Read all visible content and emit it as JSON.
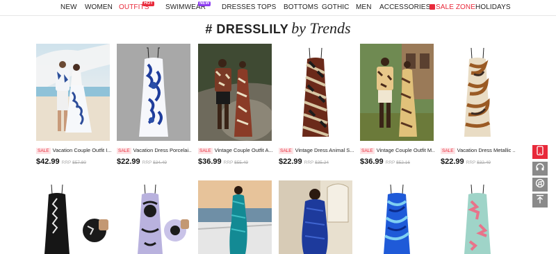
{
  "nav": {
    "items": [
      {
        "label": "NEW"
      },
      {
        "label": "WOMEN"
      },
      {
        "label": "OUTFITS",
        "badge": "HOT"
      },
      {
        "label": "SWIMWEAR",
        "badge": "NEW"
      },
      {
        "label": "DRESSES"
      },
      {
        "label": "TOPS"
      },
      {
        "label": "BOTTOMS"
      },
      {
        "label": "GOTHIC"
      },
      {
        "label": "MEN"
      },
      {
        "label": "ACCESSORIES"
      },
      {
        "label": "SALE ZONE"
      },
      {
        "label": "HOLIDAYS"
      }
    ]
  },
  "section": {
    "hash": "# DRESSLILY",
    "script": "by Trends"
  },
  "products": [
    {
      "sale": "SALE",
      "name": "Vacation Couple Outfit I...",
      "price": "$42.99",
      "rrp_label": "RRP",
      "rrp": "$57.80"
    },
    {
      "sale": "SALE",
      "name": "Vacation Dress Porcelai...",
      "price": "$22.99",
      "rrp_label": "RRP",
      "rrp": "$34.49"
    },
    {
      "sale": "SALE",
      "name": "Vintage Couple Outfit A...",
      "price": "$36.99",
      "rrp_label": "RRP",
      "rrp": "$55.49"
    },
    {
      "sale": "SALE",
      "name": "Vintage Dress Animal S...",
      "price": "$22.99",
      "rrp_label": "RRP",
      "rrp": "$35.24"
    },
    {
      "sale": "SALE",
      "name": "Vintage Couple Outfit M...",
      "price": "$36.99",
      "rrp_label": "RRP",
      "rrp": "$52.16"
    },
    {
      "sale": "SALE",
      "name": "Vacation Dress Metallic ...",
      "price": "$22.99",
      "rrp_label": "RRP",
      "rrp": "$32.49"
    }
  ],
  "colors": {
    "accent": "#e8293a",
    "hot_badge": "#e8293a",
    "new_badge": "#8c3cf0",
    "sale_bg": "#fde3e5"
  },
  "side_buttons": [
    "phone-icon",
    "headset-icon",
    "chrome-icon",
    "back-to-top-icon"
  ]
}
